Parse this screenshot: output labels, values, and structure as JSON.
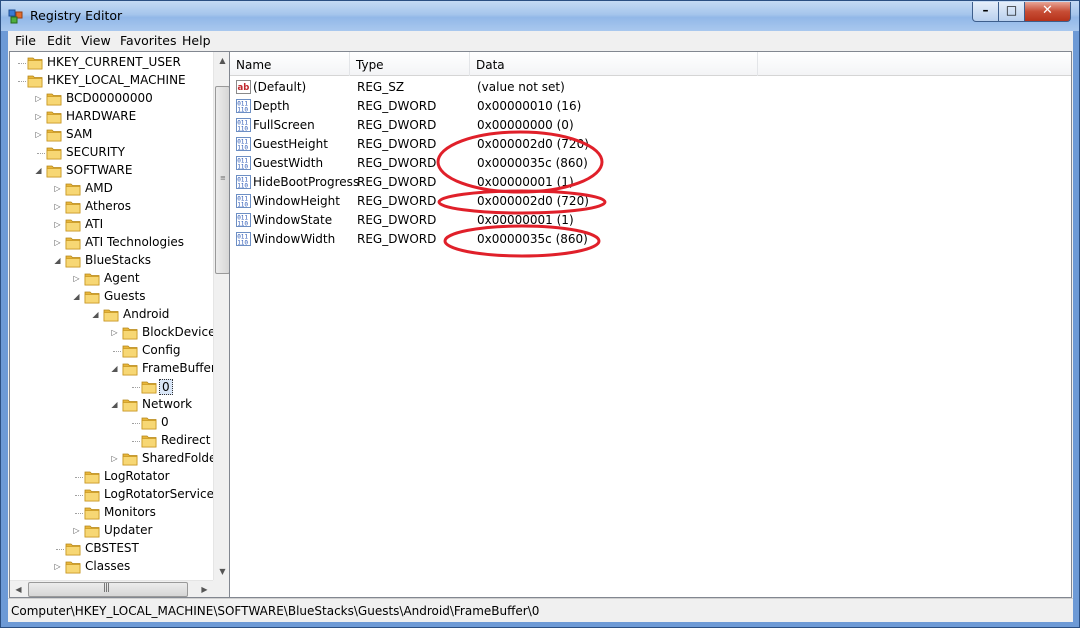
{
  "window": {
    "title": "Registry Editor"
  },
  "menu": {
    "file": "File",
    "edit": "Edit",
    "view": "View",
    "favorites": "Favorites",
    "help": "Help"
  },
  "tree": [
    {
      "label": "HKEY_CURRENT_USER",
      "depth": 0,
      "expander": ""
    },
    {
      "label": "HKEY_LOCAL_MACHINE",
      "depth": 0,
      "expander": ""
    },
    {
      "label": "BCD00000000",
      "depth": 1,
      "expander": "collapsed"
    },
    {
      "label": "HARDWARE",
      "depth": 1,
      "expander": "collapsed"
    },
    {
      "label": "SAM",
      "depth": 1,
      "expander": "collapsed"
    },
    {
      "label": "SECURITY",
      "depth": 1,
      "expander": ""
    },
    {
      "label": "SOFTWARE",
      "depth": 1,
      "expander": "expanded"
    },
    {
      "label": "AMD",
      "depth": 2,
      "expander": "collapsed"
    },
    {
      "label": "Atheros",
      "depth": 2,
      "expander": "collapsed"
    },
    {
      "label": "ATI",
      "depth": 2,
      "expander": "collapsed"
    },
    {
      "label": "ATI Technologies",
      "depth": 2,
      "expander": "collapsed"
    },
    {
      "label": "BlueStacks",
      "depth": 2,
      "expander": "expanded"
    },
    {
      "label": "Agent",
      "depth": 3,
      "expander": "collapsed"
    },
    {
      "label": "Guests",
      "depth": 3,
      "expander": "expanded"
    },
    {
      "label": "Android",
      "depth": 4,
      "expander": "expanded"
    },
    {
      "label": "BlockDevice",
      "depth": 5,
      "expander": "collapsed"
    },
    {
      "label": "Config",
      "depth": 5,
      "expander": ""
    },
    {
      "label": "FrameBuffer",
      "depth": 5,
      "expander": "expanded"
    },
    {
      "label": "0",
      "depth": 6,
      "expander": "",
      "selected": true
    },
    {
      "label": "Network",
      "depth": 5,
      "expander": "expanded"
    },
    {
      "label": "0",
      "depth": 6,
      "expander": ""
    },
    {
      "label": "Redirect",
      "depth": 6,
      "expander": ""
    },
    {
      "label": "SharedFolder",
      "depth": 5,
      "expander": "collapsed"
    },
    {
      "label": "LogRotator",
      "depth": 3,
      "expander": ""
    },
    {
      "label": "LogRotatorService",
      "depth": 3,
      "expander": ""
    },
    {
      "label": "Monitors",
      "depth": 3,
      "expander": ""
    },
    {
      "label": "Updater",
      "depth": 3,
      "expander": "collapsed"
    },
    {
      "label": "CBSTEST",
      "depth": 2,
      "expander": ""
    },
    {
      "label": "Classes",
      "depth": 2,
      "expander": "collapsed"
    }
  ],
  "list": {
    "headers": {
      "name": "Name",
      "type": "Type",
      "data": "Data"
    },
    "rows": [
      {
        "icon": "string-value-icon",
        "name": "(Default)",
        "type": "REG_SZ",
        "data": "(value not set)"
      },
      {
        "icon": "binary-value-icon",
        "name": "Depth",
        "type": "REG_DWORD",
        "data": "0x00000010 (16)"
      },
      {
        "icon": "binary-value-icon",
        "name": "FullScreen",
        "type": "REG_DWORD",
        "data": "0x00000000 (0)"
      },
      {
        "icon": "binary-value-icon",
        "name": "GuestHeight",
        "type": "REG_DWORD",
        "data": "0x000002d0 (720)"
      },
      {
        "icon": "binary-value-icon",
        "name": "GuestWidth",
        "type": "REG_DWORD",
        "data": "0x0000035c (860)"
      },
      {
        "icon": "binary-value-icon",
        "name": "HideBootProgress",
        "type": "REG_DWORD",
        "data": "0x00000001 (1)"
      },
      {
        "icon": "binary-value-icon",
        "name": "WindowHeight",
        "type": "REG_DWORD",
        "data": "0x000002d0 (720)"
      },
      {
        "icon": "binary-value-icon",
        "name": "WindowState",
        "type": "REG_DWORD",
        "data": "0x00000001 (1)"
      },
      {
        "icon": "binary-value-icon",
        "name": "WindowWidth",
        "type": "REG_DWORD",
        "data": "0x0000035c (860)"
      }
    ]
  },
  "status": {
    "path": "Computer\\HKEY_LOCAL_MACHINE\\SOFTWARE\\BlueStacks\\Guests\\Android\\FrameBuffer\\0"
  },
  "colors": {
    "annotation": "#e0202a",
    "selection": "#d9e6f7",
    "folder": "#f2c94c"
  }
}
